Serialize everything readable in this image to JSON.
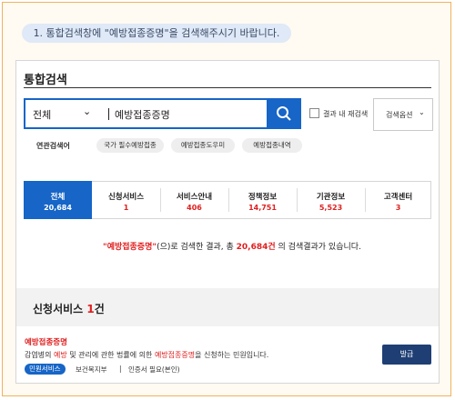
{
  "step_instruction": "1. 통합검색창에 \"예방접종증명\"을 검색해주시기 바랍니다.",
  "panel": {
    "title": "통합검색",
    "search": {
      "scope_value": "전체",
      "query_value": "예방접종증명",
      "result_within_label": "결과 내 재검색",
      "options_label": "검색옵션"
    },
    "related": {
      "label": "연관검색어",
      "tags": [
        "국가 필수예방접종",
        "예방접종도우미",
        "예방접종내역"
      ]
    },
    "tabs": [
      {
        "label": "전체",
        "count": "20,684",
        "active": true
      },
      {
        "label": "신청서비스",
        "count": "1"
      },
      {
        "label": "서비스안내",
        "count": "406"
      },
      {
        "label": "정책정보",
        "count": "14,751"
      },
      {
        "label": "기관정보",
        "count": "5,523"
      },
      {
        "label": "고객센터",
        "count": "3"
      }
    ],
    "summary": {
      "keyword": "\"예방접종증명\"",
      "part1": "(으)로 검색한 결과, 총 ",
      "total": "20,684",
      "part2": "건",
      "part3": " 의 검색결과가 있습니다."
    },
    "section": {
      "title": "신청서비스",
      "count": "1",
      "count_suffix": "건"
    },
    "result": {
      "title": "예방접종증명",
      "desc_1": "감염병의 ",
      "desc_hl1": "예방",
      "desc_2": " 및 관리에 관한 법률에 의한 ",
      "desc_hl2": "예방접종증명",
      "desc_3": "을 신청하는 민원입니다.",
      "badge": "민원서비스",
      "agency": "보건복지부",
      "note": "인증서 필요(본인)",
      "issue_button": "발급"
    }
  },
  "colors": {
    "accent": "#1665c7",
    "highlight": "#e02020",
    "button_dark": "#1f3f74"
  }
}
